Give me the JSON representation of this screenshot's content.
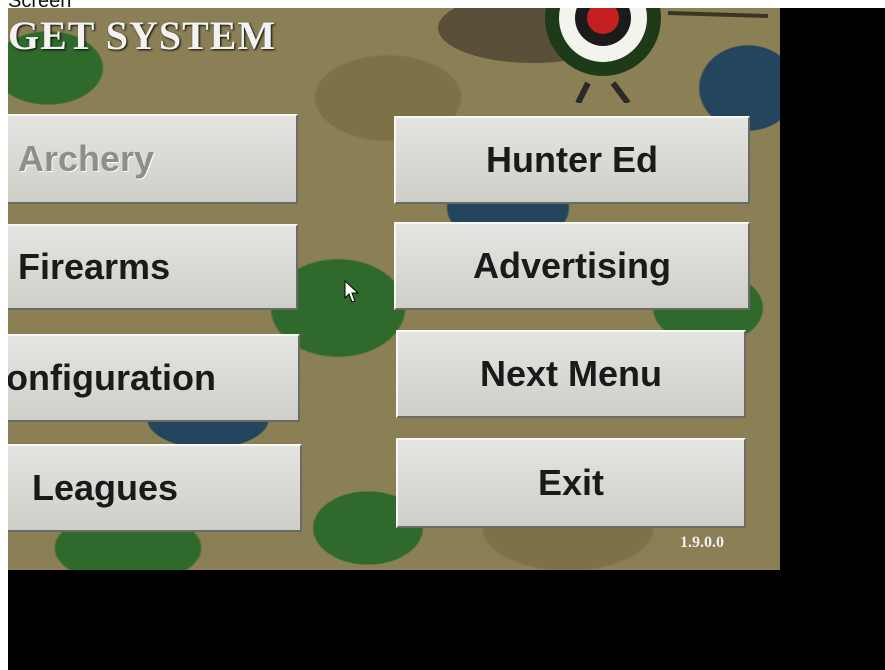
{
  "top_text": "Screen",
  "title": "GET SYSTEM",
  "version": "1.9.0.0",
  "buttons": {
    "archery": "Archery",
    "hunter_ed": "Hunter Ed",
    "firearms": "Firearms",
    "advertising": "Advertising",
    "configuration": "onfiguration",
    "next_menu": "Next Menu",
    "leagues": "Leagues",
    "exit": "Exit"
  },
  "icons": {
    "logo": "archery-target-icon",
    "cursor": "mouse-pointer-icon"
  },
  "colors": {
    "button_face": "#d9d9d5",
    "button_text": "#1a1a1a",
    "disabled_text": "#8e8e8a",
    "camo_green": "#2f6a2c",
    "camo_tan": "#8a7f55",
    "camo_blue": "#24455e"
  }
}
